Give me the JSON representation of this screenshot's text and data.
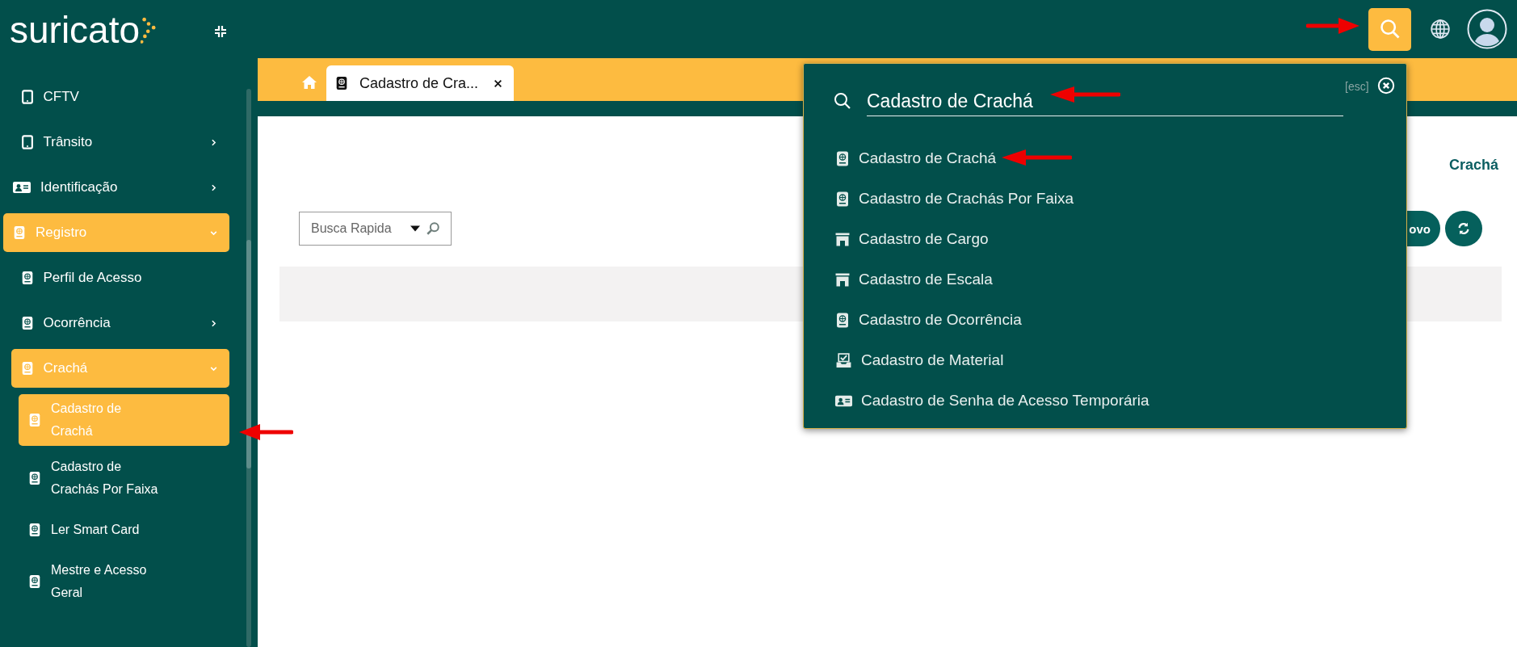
{
  "sidebar": {
    "logo": "suricato",
    "items": [
      {
        "children": [
          {
            "label": "CFTV",
            "kind": "tablet",
            "selected": false
          },
          {
            "label": "Trânsito",
            "kind": "tablet",
            "selected": false,
            "expanded": false
          }
        ]
      },
      {
        "label": "Identificação",
        "kind": "id-card",
        "selected": false,
        "expanded": false
      },
      {
        "label": "Registro",
        "kind": "badge",
        "expanded": true,
        "children": [
          {
            "label": "Perfil de Acesso",
            "kind": "badge",
            "selected": false
          },
          {
            "label": "Ocorrência",
            "kind": "badge",
            "selected": false,
            "expanded": false
          },
          {
            "label": "Crachá",
            "kind": "badge",
            "expanded": true,
            "children": [
              {
                "label": "Cadastro de Crachá",
                "kind": "badge",
                "selected": true
              },
              {
                "label": "Cadastro de Crachás Por Faixa",
                "kind": "badge",
                "selected": false
              },
              {
                "label": "Ler Smart Card",
                "kind": "badge",
                "selected": false
              },
              {
                "label": "Mestre e Acesso Geral",
                "kind": "badge",
                "selected": false
              }
            ]
          }
        ]
      }
    ]
  },
  "tabs": [
    {
      "label": "Cadastro de Cra...",
      "selected": true
    }
  ],
  "page": {
    "title": "Crachá",
    "quick_search": {
      "placeholder": "Busca Rapida"
    },
    "buttons": [
      {
        "kind": "text",
        "label": "ovo"
      },
      {
        "kind": "refresh"
      }
    ]
  },
  "search_overlay": {
    "query": "Cadastro de Crachá",
    "hint": "[esc]",
    "results": [
      {
        "label": "Cadastro de Crachá",
        "kind": "badge"
      },
      {
        "label": "Cadastro de Crachás Por Faixa",
        "kind": "badge"
      },
      {
        "label": "Cadastro de Cargo",
        "kind": "building"
      },
      {
        "label": "Cadastro de Escala",
        "kind": "building"
      },
      {
        "label": "Cadastro de Ocorrência",
        "kind": "badge"
      },
      {
        "label": "Cadastro de Material",
        "kind": "tray"
      },
      {
        "label": "Cadastro de Senha de Acesso Temporária",
        "kind": "id-card"
      }
    ]
  }
}
